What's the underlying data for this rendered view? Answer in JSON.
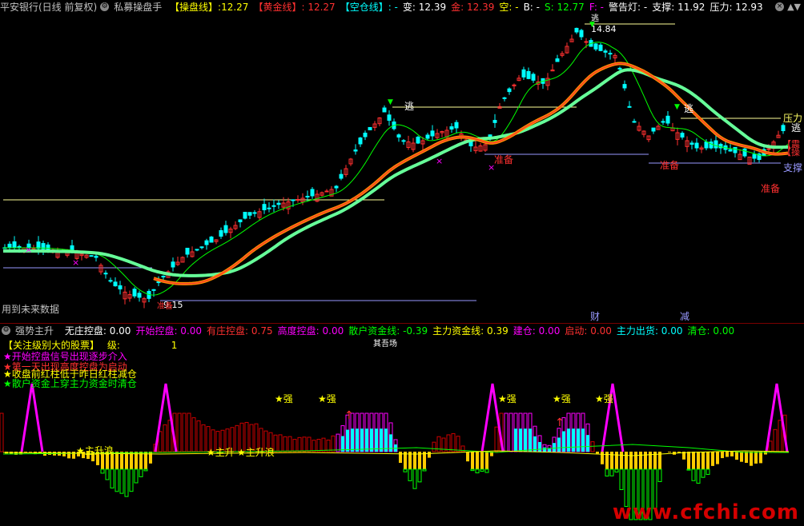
{
  "header": {
    "stock_name": "平安银行(日线 前复权)",
    "indicator_name": "私募操盘手",
    "items": [
      {
        "label": "【操盘线】",
        "value": ":12.27",
        "lc": "#ffff00",
        "vc": "#ffff00"
      },
      {
        "label": "【黄金线】",
        "value": ": 12.27",
        "lc": "#ff3030",
        "vc": "#ff3030"
      },
      {
        "label": "【空仓线】",
        "value": ": -",
        "lc": "#00ffff",
        "vc": "#00ffff"
      },
      {
        "label": "变",
        "value": ": 12.39",
        "lc": "#ffffff",
        "vc": "#ffffff"
      },
      {
        "label": "金",
        "value": ": 12.39",
        "lc": "#ff3030",
        "vc": "#ff3030"
      },
      {
        "label": "空",
        "value": ": -",
        "lc": "#ffff00",
        "vc": "#ffff00"
      },
      {
        "label": "B",
        "value": ": -",
        "lc": "#ffffff",
        "vc": "#ffffff"
      },
      {
        "label": "S",
        "value": ": 12.77",
        "lc": "#00ff00",
        "vc": "#00ff00"
      },
      {
        "label": "F",
        "value": ": -",
        "lc": "#ff00ff",
        "vc": "#ff00ff"
      },
      {
        "label": "警告灯",
        "value": ": -",
        "lc": "#ffffff",
        "vc": "#ffffff"
      },
      {
        "label": "支撑",
        "value": ": 11.92",
        "lc": "#ffffff",
        "vc": "#ffffff"
      },
      {
        "label": "压力",
        "value": ": 12.93",
        "lc": "#ffffff",
        "vc": "#ffffff"
      }
    ]
  },
  "main_chart": {
    "future_data_note": "用到未来数据",
    "labels": {
      "high_price": "14.84",
      "low_price": "9.15",
      "escape": "逃",
      "prepare": "准备",
      "pressure": "压力",
      "support": "支撑",
      "finance": "财",
      "reduce": "减",
      "left_tag_top": "【震",
      "left_tag_bottom": "【操"
    }
  },
  "indicator": {
    "name": "强势主升",
    "items": [
      {
        "label": "无庄控盘",
        "value": ": 0.00",
        "c": "#ffffff"
      },
      {
        "label": "开始控盘",
        "value": ": 0.00",
        "c": "#ff00ff"
      },
      {
        "label": "有庄控盘",
        "value": ": 0.75",
        "c": "#ff3030"
      },
      {
        "label": "高度控盘",
        "value": ": 0.00",
        "c": "#ff00ff"
      },
      {
        "label": "散户资金线",
        "value": ": -0.39",
        "c": "#00ff00"
      },
      {
        "label": "主力资金线",
        "value": ": 0.39",
        "c": "#ffff00"
      },
      {
        "label": "建仓",
        "value": ": 0.00",
        "c": "#ff00ff"
      },
      {
        "label": "启动",
        "value": ": 0.00",
        "c": "#ff3030"
      },
      {
        "label": "主力出货",
        "value": ": 0.00",
        "c": "#00ffff"
      },
      {
        "label": "清仓",
        "value": ": 0.00",
        "c": "#00ff00"
      }
    ],
    "notes": {
      "attention_label": "【关注级别大的股票】",
      "level_label": "级:",
      "level_value": "1",
      "n1": "★开始控盘信号出现逐步介入",
      "n2": "★第一天出现高度控盘为启动",
      "n3": "★收盘前红柱低于昨日红柱减仓",
      "n4": "★散户资金上穿主力资金时清仓"
    },
    "chart_labels": {
      "strong": "★强",
      "main_rise": "★主升浪",
      "main_rise_short": "★主升",
      "hidden_text": "其吾场"
    }
  },
  "watermark": "www.cfchi.com",
  "colors": {
    "up": "#ff3030",
    "down": "#00ffff",
    "ma_fast": "#ff8c00",
    "ma_slow": "#66ff99",
    "ma_alt": "#ffff66",
    "green": "#00ff00",
    "magenta": "#ff00ff",
    "yellow": "#ffff00"
  }
}
